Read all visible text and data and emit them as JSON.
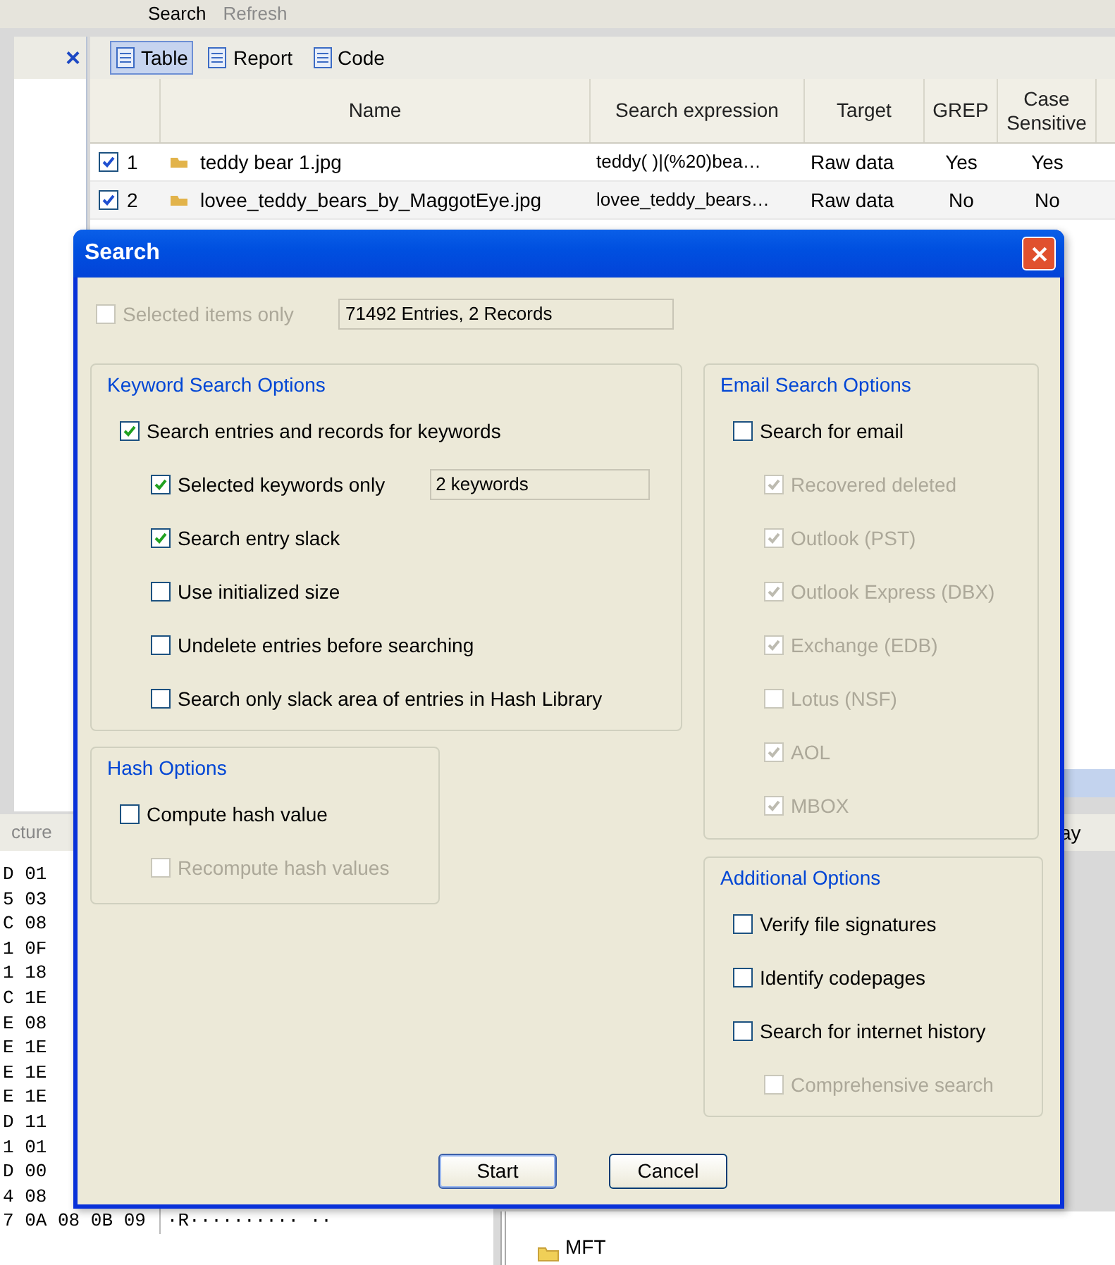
{
  "app": {
    "toolbar": [
      {
        "label": "Search",
        "disabled": false
      },
      {
        "label": "Refresh",
        "disabled": true
      }
    ],
    "close": "×",
    "views": [
      {
        "label": "Table",
        "selected": true
      },
      {
        "label": "Report",
        "selected": false
      },
      {
        "label": "Code",
        "selected": false
      }
    ],
    "table": {
      "columns": [
        "Name",
        "Search expression",
        "Target",
        "GREP",
        "Case Sensitive"
      ],
      "rows": [
        {
          "checked": true,
          "number": "1",
          "name": "teddy bear 1.jpg",
          "expression": "teddy( )|(%20)bea…",
          "target": "Raw data",
          "grep": "Yes",
          "case": "Yes"
        },
        {
          "checked": true,
          "number": "2",
          "name": "lovee_teddy_bears_by_MaggotEye.jpg",
          "expression": "lovee_teddy_bears…",
          "target": "Raw data",
          "grep": "No",
          "case": "No"
        }
      ]
    },
    "hex": {
      "header": "cture",
      "lines": [
        "D 01",
        "5 03",
        "C 08",
        "1 0F",
        "1 18",
        "C 1E",
        "E 08",
        "E 1E",
        "E 1E",
        "E 1E",
        "D 11",
        "1 01",
        "D 00",
        "4 08"
      ],
      "last_line": "7 0A 08 0B 09",
      "ascii": "·R·········· ··"
    },
    "right_label": "ay",
    "tree_item": "MFT"
  },
  "dialog": {
    "title": "Search",
    "selected_only": {
      "label": "Selected items only",
      "checked": false,
      "disabled": true
    },
    "summary": "71492 Entries, 2 Records",
    "groups": [
      {
        "title": "Keyword Search Options",
        "items": [
          {
            "label": "Search entries and records for keywords",
            "checked": true,
            "disabled": false,
            "children": [
              {
                "label": "Selected keywords only",
                "checked": true,
                "disabled": false,
                "value": "2 keywords"
              },
              {
                "label": "Search entry slack",
                "checked": true,
                "disabled": false
              },
              {
                "label": "Use initialized size",
                "checked": false,
                "disabled": false
              },
              {
                "label": "Undelete entries before searching",
                "checked": false,
                "disabled": false
              },
              {
                "label": "Search only slack area of entries in Hash Library",
                "checked": false,
                "disabled": false
              }
            ]
          }
        ]
      },
      {
        "title": "Hash Options",
        "items": [
          {
            "label": "Compute hash value",
            "checked": false,
            "disabled": false,
            "children": [
              {
                "label": "Recompute hash values",
                "checked": false,
                "disabled": true
              }
            ]
          }
        ]
      },
      {
        "title": "Email Search Options",
        "items": [
          {
            "label": "Search for email",
            "checked": false,
            "disabled": false,
            "children": [
              {
                "label": "Recovered deleted",
                "checked": true,
                "disabled": true
              },
              {
                "label": "Outlook (PST)",
                "checked": true,
                "disabled": true
              },
              {
                "label": "Outlook Express (DBX)",
                "checked": true,
                "disabled": true
              },
              {
                "label": "Exchange (EDB)",
                "checked": true,
                "disabled": true
              },
              {
                "label": "Lotus (NSF)",
                "checked": false,
                "disabled": true
              },
              {
                "label": "AOL",
                "checked": true,
                "disabled": true
              },
              {
                "label": "MBOX",
                "checked": true,
                "disabled": true
              }
            ]
          }
        ]
      },
      {
        "title": "Additional Options",
        "items": [
          {
            "label": "Verify file signatures",
            "checked": false,
            "disabled": false
          },
          {
            "label": "Identify codepages",
            "checked": false,
            "disabled": false
          },
          {
            "label": "Search for internet history",
            "checked": false,
            "disabled": false,
            "children": [
              {
                "label": "Comprehensive search",
                "checked": false,
                "disabled": true
              }
            ]
          }
        ]
      }
    ],
    "buttons": [
      "Start",
      "Cancel"
    ]
  }
}
